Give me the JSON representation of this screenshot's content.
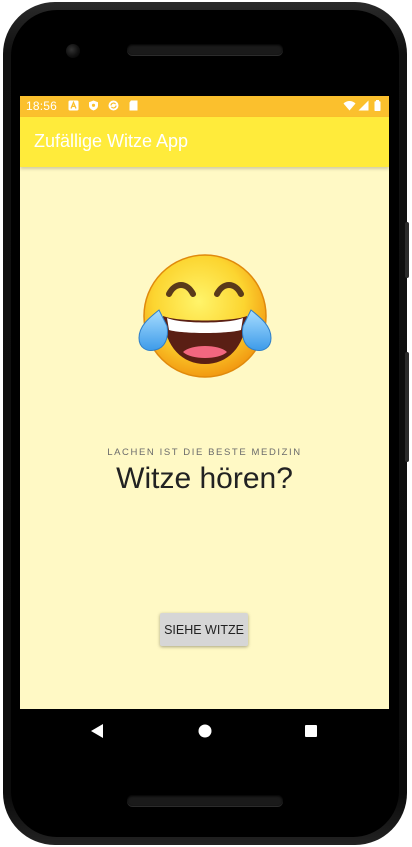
{
  "status_bar": {
    "time": "18:56",
    "left_icons": [
      "letter-a-icon",
      "shield-icon",
      "sync-icon",
      "sd-card-icon"
    ],
    "right_icons": [
      "wifi-icon",
      "signal-icon",
      "battery-icon"
    ]
  },
  "app_bar": {
    "title": "Zufällige Witze App"
  },
  "main": {
    "emoji_icon": "face-with-tears-of-joy-icon",
    "tagline": "LACHEN IST DIE BESTE MEDIZIN",
    "headline": "Witze hören?",
    "button_label": "SIEHE WITZE"
  },
  "nav_bar": {
    "icons": [
      "back-icon",
      "home-icon",
      "recents-icon"
    ]
  },
  "colors": {
    "status_bar": "#fbc02d",
    "app_bar": "#ffeb3b",
    "background": "#fff9c5",
    "button": "#d6d6d6"
  }
}
